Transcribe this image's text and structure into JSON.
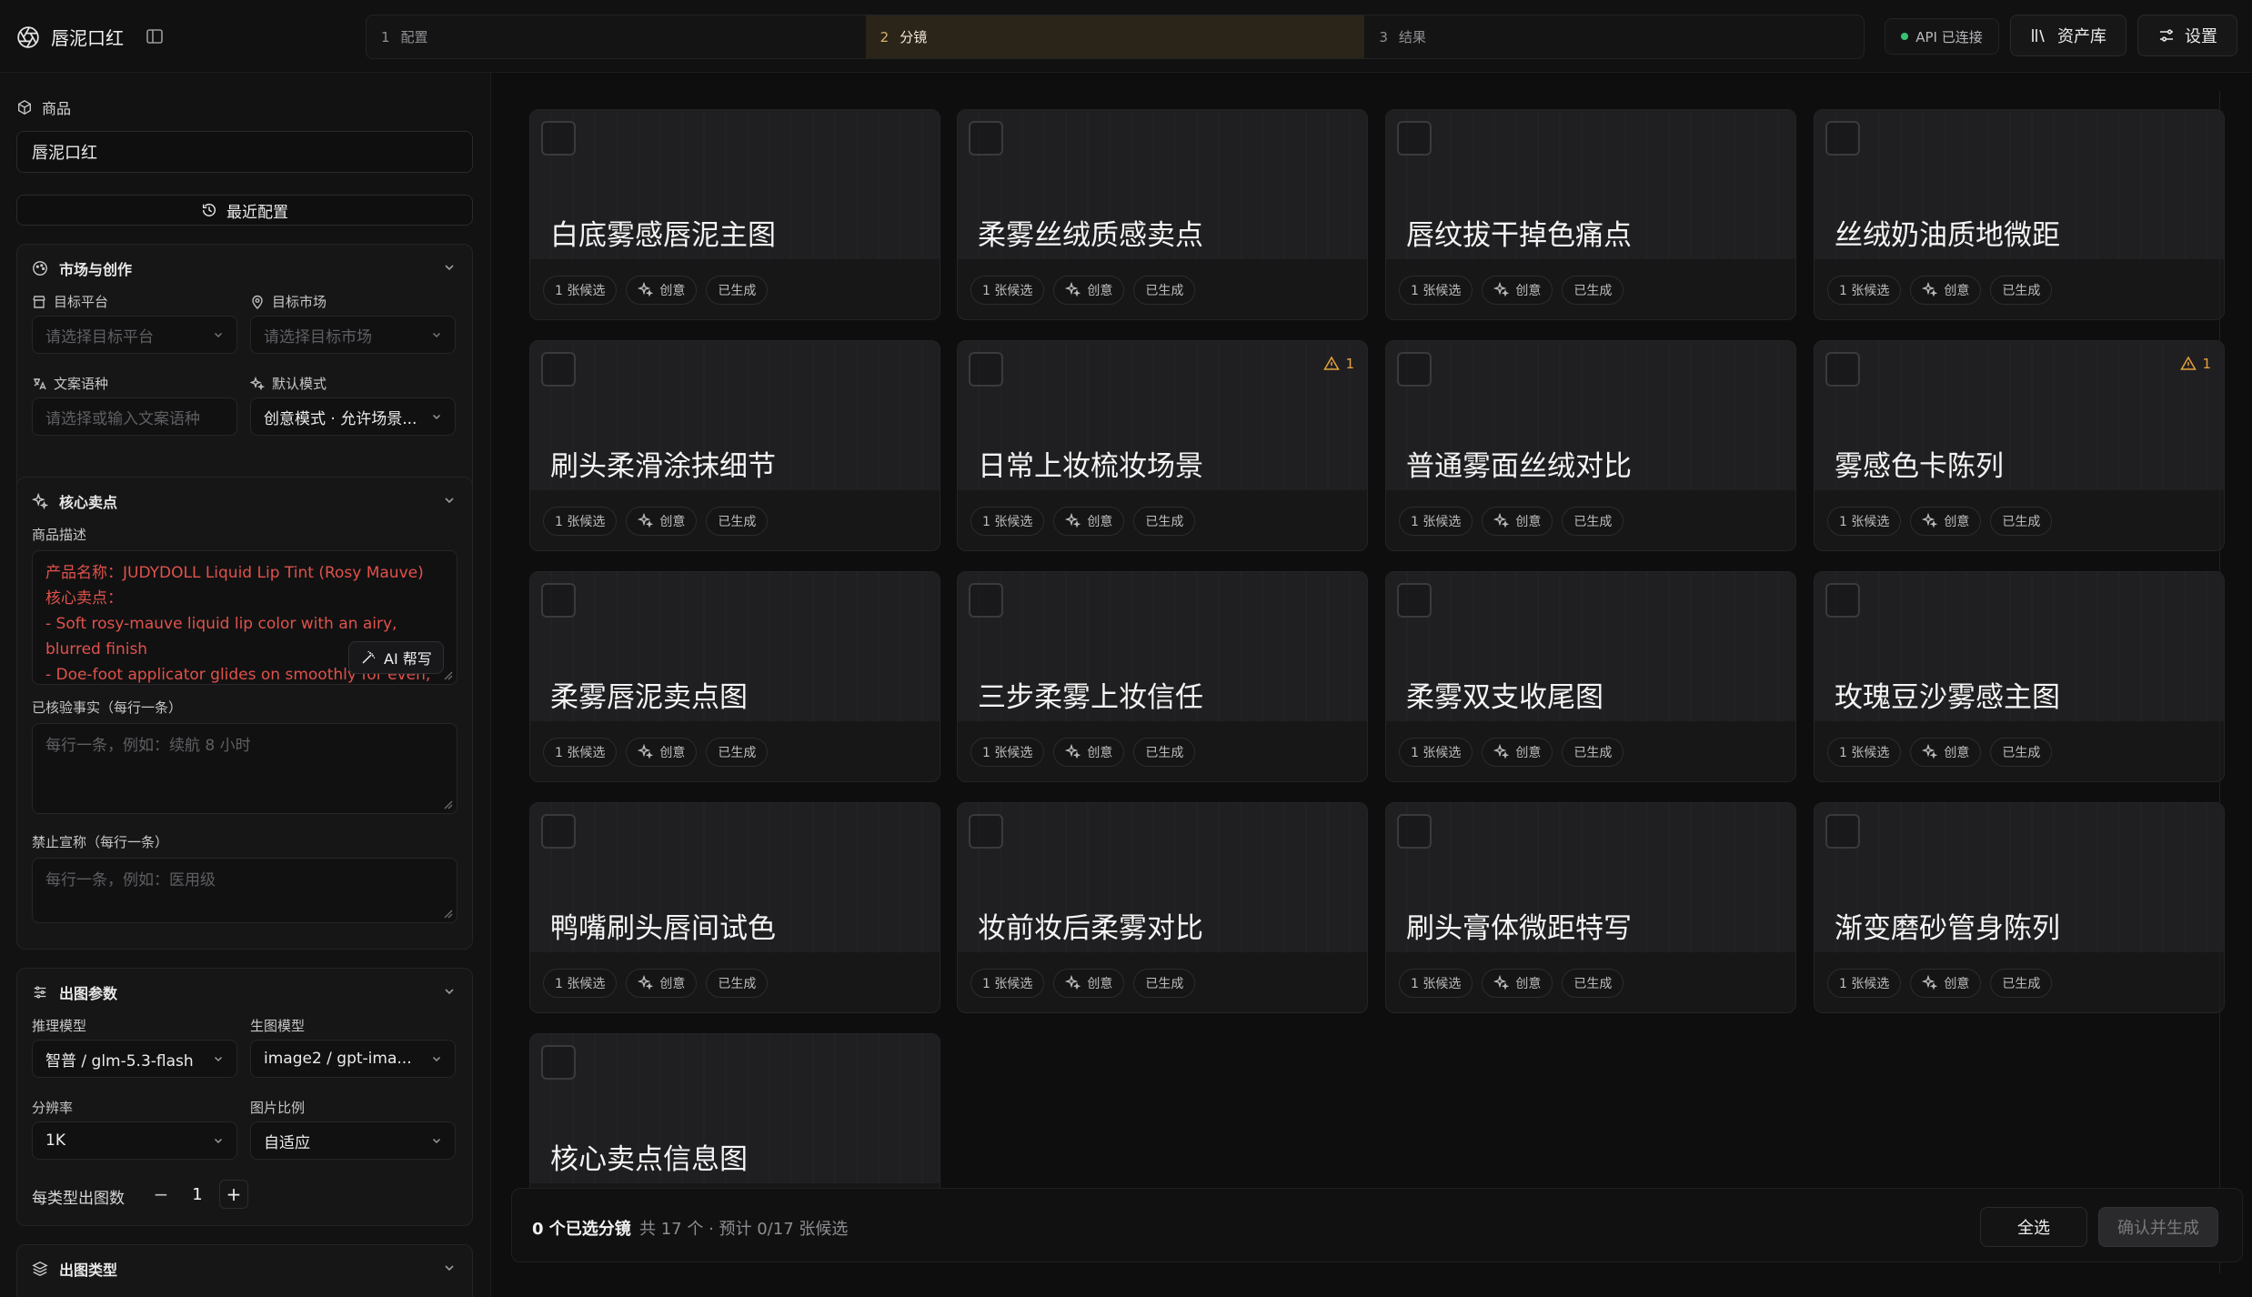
{
  "app": {
    "name": "唇泥口红"
  },
  "steps": [
    {
      "num": "1",
      "label": "配置"
    },
    {
      "num": "2",
      "label": "分镜"
    },
    {
      "num": "3",
      "label": "结果"
    }
  ],
  "header": {
    "api_status": "API 已连接",
    "assets_label": "资产库",
    "settings_label": "设置"
  },
  "sidebar": {
    "product_label": "商品",
    "product_value": "唇泥口红",
    "recent_label": "最近配置",
    "market": {
      "title": "市场与创作",
      "platform_label": "目标平台",
      "platform_placeholder": "请选择目标平台",
      "region_label": "目标市场",
      "region_placeholder": "请选择目标市场",
      "language_label": "文案语种",
      "language_placeholder": "请选择或输入文案语种",
      "mode_label": "默认模式",
      "mode_value": "创意模式 · 允许场景..."
    },
    "selling": {
      "title": "核心卖点",
      "desc_label": "商品描述",
      "desc_lines": [
        "产品名称：JUDYDOLL Liquid Lip Tint (Rosy Mauve)",
        "核心卖点：",
        "- Soft rosy-mauve liquid lip color with an airy,",
        "blurred finish",
        "- Doe-foot applicator glides on smoothly for even,"
      ],
      "ai_label": "AI 帮写",
      "facts_label": "已核验事实（每行一条）",
      "facts_placeholder": "每行一条，例如：续航 8 小时",
      "claims_label": "禁止宣称（每行一条）",
      "claims_placeholder": "每行一条，例如：医用级"
    },
    "params": {
      "title": "出图参数",
      "reason_model_label": "推理模型",
      "reason_model_value": "智普 / glm-5.3-flash",
      "image_model_label": "生图模型",
      "image_model_value": "image2 / gpt-ima...",
      "resolution_label": "分辨率",
      "resolution_value": "1K",
      "ratio_label": "图片比例",
      "ratio_value": "自适应",
      "count_label": "每类型出图数",
      "count_value": "1",
      "minus": "−",
      "plus": "+"
    },
    "types": {
      "title": "出图类型"
    }
  },
  "cards": [
    {
      "title": "白底雾感唇泥主图",
      "candidates": "1 张候选",
      "mode": "创意",
      "status": "已生成",
      "warning": ""
    },
    {
      "title": "柔雾丝绒质感卖点",
      "candidates": "1 张候选",
      "mode": "创意",
      "status": "已生成",
      "warning": ""
    },
    {
      "title": "唇纹拔干掉色痛点",
      "candidates": "1 张候选",
      "mode": "创意",
      "status": "已生成",
      "warning": ""
    },
    {
      "title": "丝绒奶油质地微距",
      "candidates": "1 张候选",
      "mode": "创意",
      "status": "已生成",
      "warning": ""
    },
    {
      "title": "刷头柔滑涂抹细节",
      "candidates": "1 张候选",
      "mode": "创意",
      "status": "已生成",
      "warning": ""
    },
    {
      "title": "日常上妆梳妆场景",
      "candidates": "1 张候选",
      "mode": "创意",
      "status": "已生成",
      "warning": "1"
    },
    {
      "title": "普通雾面丝绒对比",
      "candidates": "1 张候选",
      "mode": "创意",
      "status": "已生成",
      "warning": ""
    },
    {
      "title": "雾感色卡陈列",
      "candidates": "1 张候选",
      "mode": "创意",
      "status": "已生成",
      "warning": "1"
    },
    {
      "title": "柔雾唇泥卖点图",
      "candidates": "1 张候选",
      "mode": "创意",
      "status": "已生成",
      "warning": ""
    },
    {
      "title": "三步柔雾上妆信任",
      "candidates": "1 张候选",
      "mode": "创意",
      "status": "已生成",
      "warning": ""
    },
    {
      "title": "柔雾双支收尾图",
      "candidates": "1 张候选",
      "mode": "创意",
      "status": "已生成",
      "warning": ""
    },
    {
      "title": "玫瑰豆沙雾感主图",
      "candidates": "1 张候选",
      "mode": "创意",
      "status": "已生成",
      "warning": ""
    },
    {
      "title": "鸭嘴刷头唇间试色",
      "candidates": "1 张候选",
      "mode": "创意",
      "status": "已生成",
      "warning": ""
    },
    {
      "title": "妆前妆后柔雾对比",
      "candidates": "1 张候选",
      "mode": "创意",
      "status": "已生成",
      "warning": ""
    },
    {
      "title": "刷头膏体微距特写",
      "candidates": "1 张候选",
      "mode": "创意",
      "status": "已生成",
      "warning": ""
    },
    {
      "title": "渐变磨砂管身陈列",
      "candidates": "1 张候选",
      "mode": "创意",
      "status": "已生成",
      "warning": ""
    },
    {
      "title": "核心卖点信息图",
      "candidates": "",
      "mode": "",
      "status": "",
      "warning": ""
    }
  ],
  "footer": {
    "selected": "0 个已选分镜",
    "summary": "共 17 个 · 预计 0/17 张候选",
    "select_all": "全选",
    "confirm": "确认并生成"
  },
  "colors": {
    "accent": "#d7b26a",
    "warning": "#e6a23c",
    "desc_text": "#e0524b",
    "status_ok": "#38c172"
  }
}
